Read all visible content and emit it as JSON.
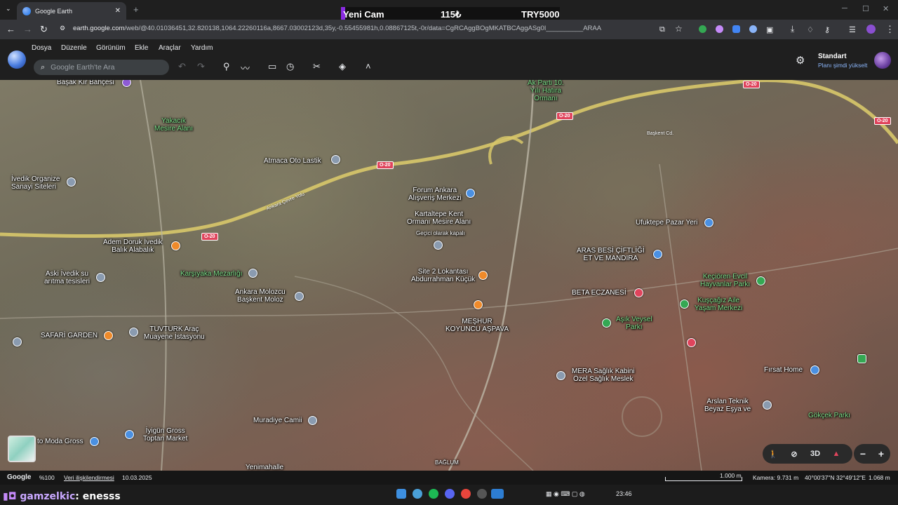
{
  "browser": {
    "tab_title": "Google Earth",
    "tab_close": "✕",
    "new_tab": "+",
    "url_host": "earth.google.com",
    "url_path": "/web/@40.01036451,32.820138,1064.22260116a,8667.03002123d,35y,-0.55455981h,0.08867125t,-0r/data=CgRCAggBOgMKATBCAggASg0I__________ARAA",
    "window_min": "─",
    "window_max": "☐",
    "window_close": "✕"
  },
  "stream_overlay": {
    "item": "Yeni Cam",
    "price": "115₺",
    "goal": "TRY5000"
  },
  "menus": [
    "Dosya",
    "Düzenle",
    "Görünüm",
    "Ekle",
    "Araçlar",
    "Yardım"
  ],
  "search": {
    "placeholder": "Google Earth'te Ara"
  },
  "plan": {
    "title": "Standart",
    "upgrade": "Planı şimdi yükselt"
  },
  "map": {
    "pois": [
      {
        "text": "Başak Kır Bahçesi",
        "kind": "white"
      },
      {
        "text": "Yakacık\nMesire Alanı",
        "kind": "green"
      },
      {
        "text": "Atmaca Oto Lastik",
        "kind": "white"
      },
      {
        "text": "İvedik Organize\nSanayi Siteleri",
        "kind": "white"
      },
      {
        "text": "Ak Parti 10.\nYılı Hatıra\nOrmanı",
        "kind": "green"
      },
      {
        "text": "Forum Ankara\nAlışveriş Merkezi",
        "kind": "white"
      },
      {
        "text": "Kartaltepe Kent\nOrmanı Mesire Alanı",
        "kind": "white"
      },
      {
        "text": "Geçici olarak kapalı",
        "kind": "small"
      },
      {
        "text": "Ufuktepe Pazar Yeri",
        "kind": "white"
      },
      {
        "text": "ARAS BESİ ÇİFTLİĞİ\nET VE MANDIRA",
        "kind": "white"
      },
      {
        "text": "Adem Doruk İvedik\nBalık Alabalık",
        "kind": "white"
      },
      {
        "text": "Karşıyaka Mezarlığı",
        "kind": "green"
      },
      {
        "text": "Aski İvedik su\narıtma tesisleri",
        "kind": "white"
      },
      {
        "text": "Site 2 Lokantası\nAbdurrahman Küçük",
        "kind": "white"
      },
      {
        "text": "BETA ECZANESİ",
        "kind": "white"
      },
      {
        "text": "Keçiören Evcil\nHayvanlar Parkı",
        "kind": "green"
      },
      {
        "text": "Kuşçağız Aile\nYaşam Merkezi",
        "kind": "green"
      },
      {
        "text": "Ankara Molozcu\nBaşkent Moloz",
        "kind": "white"
      },
      {
        "text": "Aşık Veysel\nParkı",
        "kind": "green"
      },
      {
        "text": "MEŞHUR\nKOYUNCU AŞPAVA",
        "kind": "white"
      },
      {
        "text": "TUVTURK Araç\nMuayene İstasyonu",
        "kind": "white"
      },
      {
        "text": "SAFARİ GARDEN",
        "kind": "white"
      },
      {
        "text": "MERA Sağlık Kabini\nÖzel Sağlık Meslek",
        "kind": "white"
      },
      {
        "text": "Fırsat Home",
        "kind": "white"
      },
      {
        "text": "Arslan Teknik\nBeyaz Eşya ve",
        "kind": "white"
      },
      {
        "text": "Gökçek Parkı",
        "kind": "green"
      },
      {
        "text": "Muradiye Camii",
        "kind": "white"
      },
      {
        "text": "İyigün Gross\nToptan Market",
        "kind": "white"
      },
      {
        "text": "to Moda Gross",
        "kind": "white"
      },
      {
        "text": "Yenimahalle",
        "kind": "white"
      },
      {
        "text": "BAĞLUM",
        "kind": "white"
      },
      {
        "text": "Ankara Çevre Yolu",
        "kind": "road"
      },
      {
        "text": "Başkent Cd.",
        "kind": "road"
      }
    ],
    "road_badges": [
      "O-20",
      "O-20",
      "O-20",
      "O-20",
      "O-20"
    ],
    "controls": {
      "pegman": "🚶",
      "compass_off": "⊘",
      "mode": "3D",
      "compass": "▲",
      "zoom_out": "−",
      "zoom_in": "+"
    }
  },
  "status": {
    "brand": "Google",
    "zoom": "%100",
    "credits": "Veri ilişkilendirmesi",
    "date": "10.03.2025",
    "scale": "1.000 m",
    "camera": "Kamera: 9.731 m",
    "coords": "40°00'37\"N 32°49'12\"E",
    "elevation": "1.068 m"
  },
  "taskbar": {
    "streamer_user": "gamzelkic",
    "streamer_msg": ": enesss",
    "time": "23:46"
  }
}
